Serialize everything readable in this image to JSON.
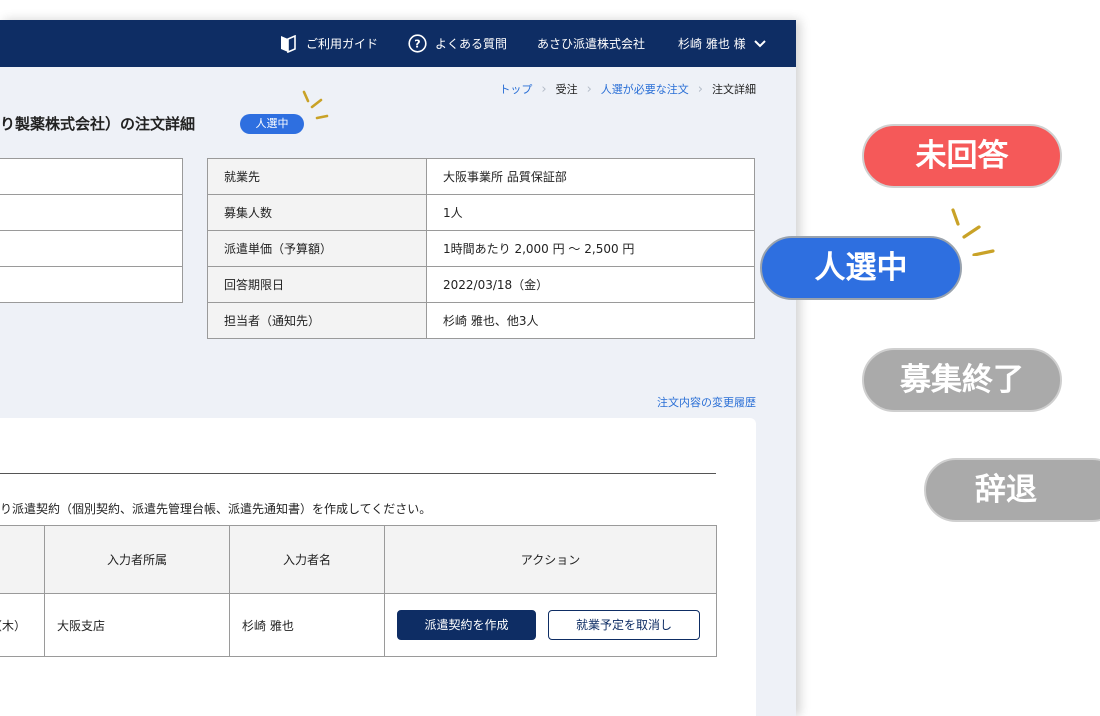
{
  "header": {
    "guide": "ご利用ガイド",
    "faq": "よくある質問",
    "company": "あさひ派遣株式会社",
    "user": "杉崎 雅也 様"
  },
  "breadcrumb": [
    "トップ",
    "受注",
    "人選が必要な注文",
    "注文詳細"
  ],
  "page": {
    "title": "り製薬株式会社）の注文詳細",
    "status_badge": "人選中"
  },
  "info_table": [
    {
      "label": "就業先",
      "value": "大阪事業所 品質保証部"
    },
    {
      "label": "募集人数",
      "value": "1人"
    },
    {
      "label": "派遣単価（予算額）",
      "value": "1時間あたり 2,000 円 ～ 2,500 円"
    },
    {
      "label": "回答期限日",
      "value": "2022/03/18（金）"
    },
    {
      "label": "担当者（通知先）",
      "value": "杉崎 雅也、他3人"
    }
  ],
  "history_link": "注文内容の変更履歴",
  "contract": {
    "note": "り派遣契約（個別契約、派遣先管理台帳、派遣先通知書）を作成してください。",
    "headers": [
      "入力者所属",
      "入力者名",
      "アクション"
    ],
    "row": {
      "date_tail": "（木）",
      "dept": "大阪支店",
      "name": "杉崎 雅也",
      "create_label": "派遣契約を作成",
      "cancel_label": "就業予定を取消し"
    }
  },
  "status_labels": {
    "unanswered": "未回答",
    "selecting": "人選中",
    "closed": "募集終了",
    "declined": "辞退"
  },
  "colors": {
    "navy": "#0e2d64",
    "blue": "#2e6fe0",
    "red": "#f55959",
    "gray": "#aaaaaa",
    "link": "#2a6fd6",
    "sparkle": "#c9a227"
  }
}
